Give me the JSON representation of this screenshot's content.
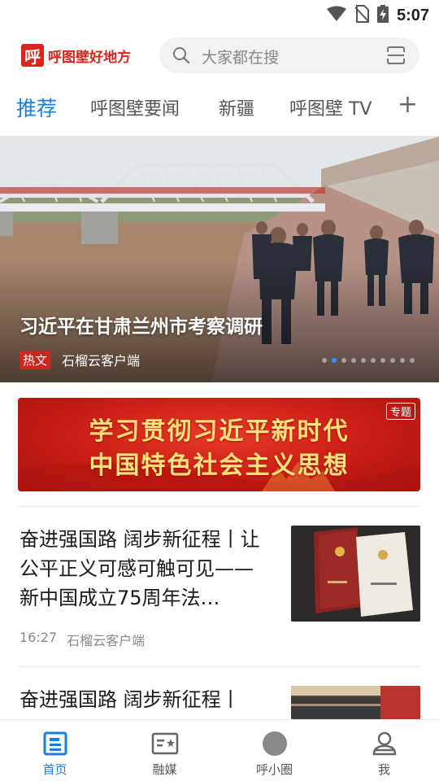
{
  "status_bar": {
    "time": "5:07",
    "icons": [
      "wifi-icon",
      "no-sim-icon",
      "battery-charging-icon"
    ]
  },
  "header": {
    "logo_mark": "呼",
    "logo_text": "呼图壁好地方",
    "search_placeholder": "大家都在搜",
    "scan_icon": "scan-icon"
  },
  "tabs": [
    {
      "label": "推荐",
      "active": true
    },
    {
      "label": "呼图壁要闻"
    },
    {
      "label": "新疆"
    },
    {
      "label": "呼图壁 TV"
    }
  ],
  "tabs_more": "+",
  "hero": {
    "title": "习近平在甘肃兰州市考察调研",
    "badge": "热文",
    "source": "石榴云客户端",
    "slide_count": 10,
    "active_slide": 2
  },
  "banner": {
    "line1": "学习贯彻习近平新时代",
    "line2": "中国特色社会主义思想",
    "tag": "专题"
  },
  "articles": [
    {
      "title": "奋进强国路 阔步新征程丨让公平正义可感可触可见——新中国成立75周年法…",
      "time": "16:27",
      "source": "石榴云客户端"
    },
    {
      "title": "奋进强国路 阔步新征程丨"
    }
  ],
  "bottom_nav": [
    {
      "label": "首页",
      "icon": "home-news-icon",
      "active": true
    },
    {
      "label": "融媒",
      "icon": "media-icon"
    },
    {
      "label": "呼小圈",
      "icon": "circle-icon"
    },
    {
      "label": "我",
      "icon": "user-icon"
    }
  ],
  "colors": {
    "accent": "#1a7de0",
    "brand_red": "#d9261c",
    "badge_red": "#c8281e"
  }
}
